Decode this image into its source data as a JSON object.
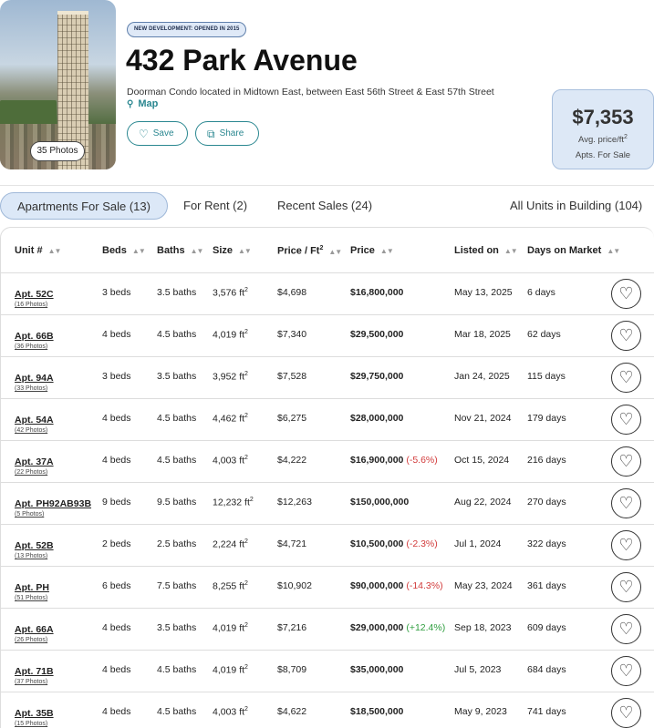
{
  "photo": {
    "count_label": "35 Photos"
  },
  "header": {
    "badge": "NEW DEVELOPMENT: OPENED IN 2015",
    "title": "432 Park Avenue",
    "subtitle": "Doorman Condo located in Midtown East, between East 56th Street & East 57th Street",
    "map_label": "Map",
    "save_label": "Save",
    "share_label": "Share"
  },
  "price_box": {
    "value": "$7,353",
    "label_line1": "Avg. price/ft",
    "label_line1_sup": "2",
    "label_line2": "Apts. For Sale"
  },
  "tabs": {
    "for_sale": "Apartments For Sale (13)",
    "for_rent": "For Rent (2)",
    "recent_sales": "Recent Sales (24)",
    "all_units": "All Units in Building (104)"
  },
  "columns": {
    "unit": "Unit #",
    "beds": "Beds",
    "baths": "Baths",
    "size": "Size",
    "ppsf": "Price / Ft",
    "ppsf_sup": "2",
    "price": "Price",
    "listed": "Listed on",
    "dom": "Days on Market"
  },
  "rows": [
    {
      "unit": "Apt. 52C",
      "photos": "(16 Photos)",
      "beds": "3 beds",
      "baths": "3.5 baths",
      "size": "3,576 ft",
      "ppsf": "$4,698",
      "price": "$16,800,000",
      "change": "",
      "change_type": "",
      "listed": "May 13, 2025",
      "dom": "6 days"
    },
    {
      "unit": "Apt. 66B",
      "photos": "(36 Photos)",
      "beds": "4 beds",
      "baths": "4.5 baths",
      "size": "4,019 ft",
      "ppsf": "$7,340",
      "price": "$29,500,000",
      "change": "",
      "change_type": "",
      "listed": "Mar 18, 2025",
      "dom": "62 days"
    },
    {
      "unit": "Apt. 94A",
      "photos": "(33 Photos)",
      "beds": "3 beds",
      "baths": "3.5 baths",
      "size": "3,952 ft",
      "ppsf": "$7,528",
      "price": "$29,750,000",
      "change": "",
      "change_type": "",
      "listed": "Jan 24, 2025",
      "dom": "115 days"
    },
    {
      "unit": "Apt. 54A",
      "photos": "(42 Photos)",
      "beds": "4 beds",
      "baths": "4.5 baths",
      "size": "4,462 ft",
      "ppsf": "$6,275",
      "price": "$28,000,000",
      "change": "",
      "change_type": "",
      "listed": "Nov 21, 2024",
      "dom": "179 days"
    },
    {
      "unit": "Apt. 37A",
      "photos": "(22 Photos)",
      "beds": "4 beds",
      "baths": "4.5 baths",
      "size": "4,003 ft",
      "ppsf": "$4,222",
      "price": "$16,900,000",
      "change": "(-5.6%)",
      "change_type": "neg",
      "listed": "Oct 15, 2024",
      "dom": "216 days"
    },
    {
      "unit": "Apt. PH92AB93B",
      "photos": "(5 Photos)",
      "beds": "9 beds",
      "baths": "9.5 baths",
      "size": "12,232 ft",
      "ppsf": "$12,263",
      "price": "$150,000,000",
      "change": "",
      "change_type": "",
      "listed": "Aug 22, 2024",
      "dom": "270 days"
    },
    {
      "unit": "Apt. 52B",
      "photos": "(13 Photos)",
      "beds": "2 beds",
      "baths": "2.5 baths",
      "size": "2,224 ft",
      "ppsf": "$4,721",
      "price": "$10,500,000",
      "change": "(-2.3%)",
      "change_type": "neg",
      "listed": "Jul 1, 2024",
      "dom": "322 days"
    },
    {
      "unit": "Apt. PH",
      "photos": "(51 Photos)",
      "beds": "6 beds",
      "baths": "7.5 baths",
      "size": "8,255 ft",
      "ppsf": "$10,902",
      "price": "$90,000,000",
      "change": "(-14.3%)",
      "change_type": "neg",
      "listed": "May 23, 2024",
      "dom": "361 days"
    },
    {
      "unit": "Apt. 66A",
      "photos": "(26 Photos)",
      "beds": "4 beds",
      "baths": "3.5 baths",
      "size": "4,019 ft",
      "ppsf": "$7,216",
      "price": "$29,000,000",
      "change": "(+12.4%)",
      "change_type": "pos",
      "listed": "Sep 18, 2023",
      "dom": "609 days"
    },
    {
      "unit": "Apt. 71B",
      "photos": "(37 Photos)",
      "beds": "4 beds",
      "baths": "4.5 baths",
      "size": "4,019 ft",
      "ppsf": "$8,709",
      "price": "$35,000,000",
      "change": "",
      "change_type": "",
      "listed": "Jul 5, 2023",
      "dom": "684 days"
    },
    {
      "unit": "Apt. 35B",
      "photos": "(15 Photos)",
      "beds": "4 beds",
      "baths": "4.5 baths",
      "size": "4,003 ft",
      "ppsf": "$4,622",
      "price": "$18,500,000",
      "change": "",
      "change_type": "",
      "listed": "May 9, 2023",
      "dom": "741 days"
    }
  ],
  "size_unit_sup": "2",
  "icons": {
    "heart": "heart-icon",
    "pin": "map-pin-icon",
    "sort": "sort-icon",
    "share": "share-icon"
  },
  "colors": {
    "accent": "#2a8790",
    "badge_bg": "#dfe9f7",
    "price_box_bg": "#dde8f6",
    "negative": "#d23b3b",
    "positive": "#2f9e3f"
  }
}
